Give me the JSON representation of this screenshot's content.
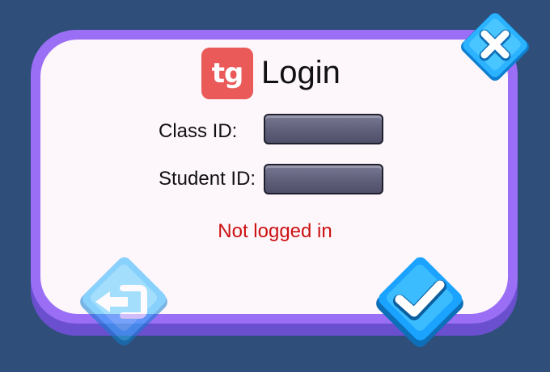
{
  "dialog": {
    "logo_text": "tg",
    "title": "Login",
    "status_text": "Not logged in",
    "status_color": "#cc1111"
  },
  "form": {
    "class_id": {
      "label": "Class ID:",
      "value": ""
    },
    "student_id": {
      "label": "Student ID:",
      "value": ""
    }
  },
  "buttons": {
    "close": {
      "icon": "close-x-icon"
    },
    "back": {
      "icon": "exit-arrow-icon",
      "disabled": true
    },
    "confirm": {
      "icon": "checkmark-icon"
    }
  },
  "colors": {
    "background": "#2f4f7a",
    "panel_border": "#9a6ef5",
    "panel_fill": "#fdf6fb",
    "logo": "#e95a59",
    "button_blue": "#1aa3ff"
  }
}
